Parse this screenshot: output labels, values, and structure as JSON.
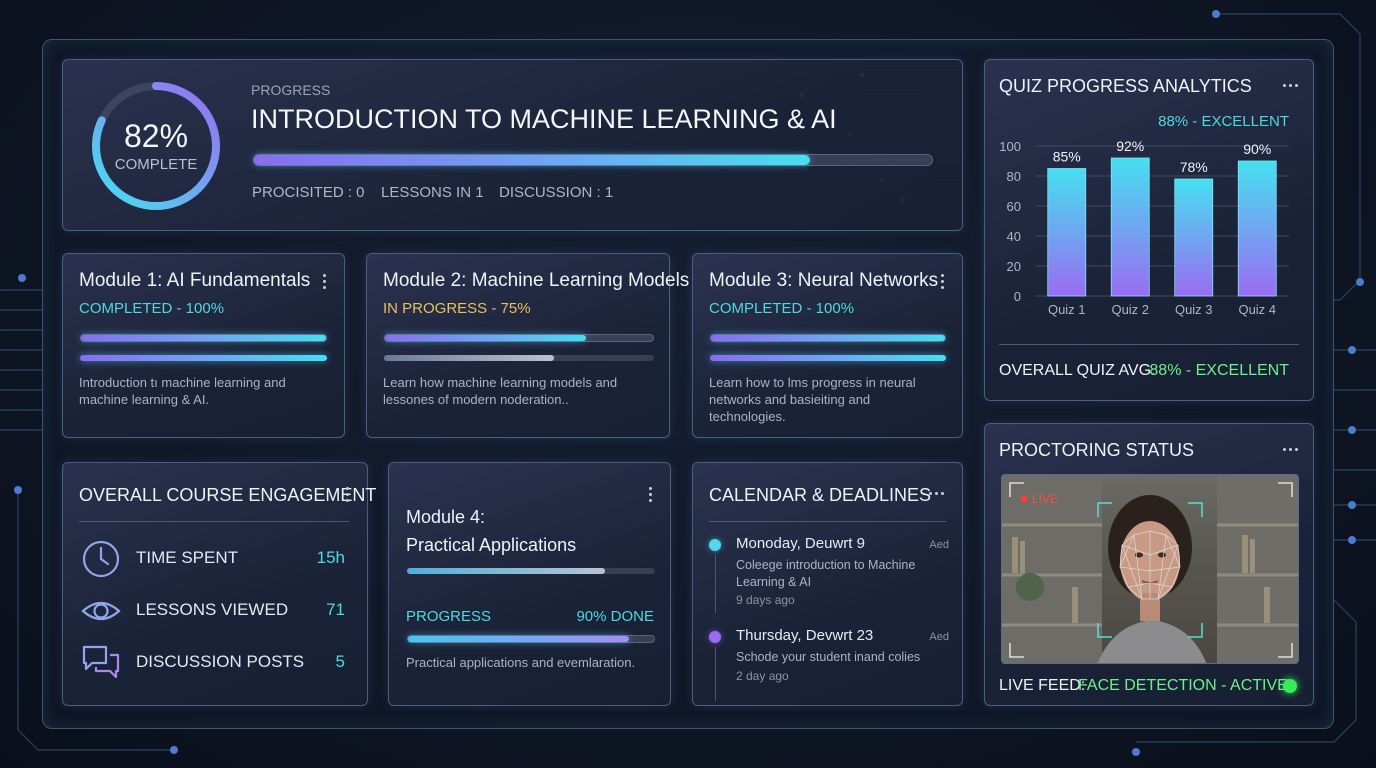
{
  "header": {
    "progress_label": "PROGRESS",
    "course_title": "INTRODUCTION TO MACHINE LEARNING & AI",
    "progress_percent": 82,
    "percent_text": "82%",
    "complete_label": "COMPLETE",
    "bar_fraction": 0.82,
    "stats": {
      "processed": "PROCISITED : 0",
      "lessons": "LESSONS IN 1",
      "discussion": "DISCUSSION : 1"
    }
  },
  "modules": [
    {
      "title": "Module 1: AI Fundamentals",
      "status": "COMPLETED - 100%",
      "desc": "Introduction tı machine learning and machine learning & AI.",
      "fill": 1.0,
      "fill2": 1.0
    },
    {
      "title": "Module 2: Machine Learning Models",
      "status": "IN PROGRESS - 75%",
      "desc": "Learn how machine learning models and lessones of modern noderation..",
      "fill": 0.75,
      "fill2": 0.63
    },
    {
      "title": "Module 3: Neural Networks",
      "status": "COMPLETED - 100%",
      "desc": "Learn how to lms progress in neural networks and basieiting and technologies.",
      "fill": 1.0,
      "fill2": 1.0
    }
  ],
  "module4": {
    "title_line1": "Module 4:",
    "title_line2": "Practical Applications",
    "top_fill": 0.8,
    "progress_label": "PROGRESS",
    "done_text": "90% DONE",
    "progress_fill": 0.9,
    "desc": "Practical applications and evemlaration."
  },
  "engagement": {
    "title": "OVERALL COURSE ENGAGEMENT",
    "rows": [
      {
        "icon": "clock-icon",
        "label": "TIME SPENT",
        "value": "15h"
      },
      {
        "icon": "eye-icon",
        "label": "LESSONS VIEWED",
        "value": "71"
      },
      {
        "icon": "chat-icon",
        "label": "DISCUSSION POSTS",
        "value": "5"
      }
    ]
  },
  "calendar": {
    "title": "CALENDAR & DEADLINES",
    "events": [
      {
        "date": "Monoday, Deuwrt 9",
        "tag": "Aed",
        "desc": "Coleege introduction to Machine Learning & AI",
        "ago": "9 days ago",
        "dot_color": "#4fd8f0"
      },
      {
        "date": "Thursday, Devwrt 23",
        "tag": "Aed",
        "desc": "Schode your student inand colies",
        "ago": "2 day ago",
        "dot_color": "#9a6cf2"
      }
    ]
  },
  "quiz": {
    "title": "QUIZ PROGRESS ANALYTICS",
    "badge": "88% - EXCELLENT",
    "overall_label": "OVERALL QUIZ AVG.",
    "overall_value": "88% - EXCELLENT"
  },
  "proctoring": {
    "title": "PROCTORING STATUS",
    "live_tag": "LIVE",
    "feed_label": "LIVE FEED:",
    "feed_status": "FACE DETECTION - ACTIVE"
  },
  "colors": {
    "accent_teal": "#4fd8e0",
    "accent_purple": "#8a6cf2",
    "status_gold": "#e8c15a",
    "status_green": "#6ff08a"
  },
  "chart_data": {
    "type": "bar",
    "categories": [
      "Quiz 1",
      "Quiz 2",
      "Quiz 3",
      "Quiz 4"
    ],
    "values": [
      85,
      92,
      78,
      90
    ],
    "data_labels": [
      "85%",
      "92%",
      "78%",
      "90%"
    ],
    "y_ticks": [
      0,
      20,
      40,
      60,
      80,
      100
    ],
    "ylim": [
      0,
      100
    ],
    "grid": true
  }
}
